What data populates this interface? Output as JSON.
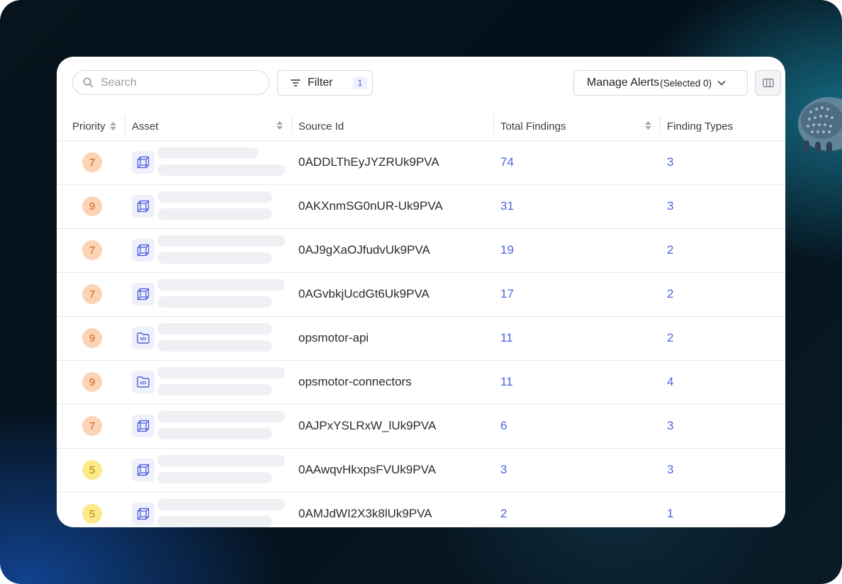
{
  "toolbar": {
    "search_placeholder": "Search",
    "filter_label": "Filter",
    "filter_count": "1",
    "manage_label": "Manage Alerts",
    "manage_selected": "(Selected 0)"
  },
  "table": {
    "columns": [
      "Priority",
      "Asset",
      "Source Id",
      "Total Findings",
      "Finding Types"
    ],
    "rows": [
      {
        "priority": "7",
        "priority_level": "high",
        "asset_icon": "cube-icon",
        "source_id": "0ADDLThEyJYZRUk9PVA",
        "total_findings": "74",
        "finding_types": "3"
      },
      {
        "priority": "9",
        "priority_level": "high",
        "asset_icon": "cube-icon",
        "source_id": "0AKXnmSG0nUR-Uk9PVA",
        "total_findings": "31",
        "finding_types": "3"
      },
      {
        "priority": "7",
        "priority_level": "high",
        "asset_icon": "cube-icon",
        "source_id": "0AJ9gXaOJfudvUk9PVA",
        "total_findings": "19",
        "finding_types": "2"
      },
      {
        "priority": "7",
        "priority_level": "high",
        "asset_icon": "cube-icon",
        "source_id": "0AGvbkjUcdGt6Uk9PVA",
        "total_findings": "17",
        "finding_types": "2"
      },
      {
        "priority": "9",
        "priority_level": "high",
        "asset_icon": "code-folder-icon",
        "source_id": "opsmotor-api",
        "total_findings": "11",
        "finding_types": "2"
      },
      {
        "priority": "9",
        "priority_level": "high",
        "asset_icon": "code-folder-icon",
        "source_id": "opsmotor-connectors",
        "total_findings": "11",
        "finding_types": "4"
      },
      {
        "priority": "7",
        "priority_level": "high",
        "asset_icon": "cube-icon",
        "source_id": "0AJPxYSLRxW_lUk9PVA",
        "total_findings": "6",
        "finding_types": "3"
      },
      {
        "priority": "5",
        "priority_level": "medium",
        "asset_icon": "cube-icon",
        "source_id": "0AAwqvHkxpsFVUk9PVA",
        "total_findings": "3",
        "finding_types": "3"
      },
      {
        "priority": "5",
        "priority_level": "medium",
        "asset_icon": "cube-icon",
        "source_id": "0AMJdWI2X3k8lUk9PVA",
        "total_findings": "2",
        "finding_types": "1"
      }
    ]
  },
  "colors": {
    "link": "#4f62e0",
    "priority_high_bg": "#fcd3b4",
    "priority_high_text": "#d2601a",
    "priority_medium_bg": "#fbe98a",
    "priority_medium_text": "#a8880c",
    "icon_bg": "#eef0fb",
    "icon_stroke": "#4f5fd6"
  }
}
